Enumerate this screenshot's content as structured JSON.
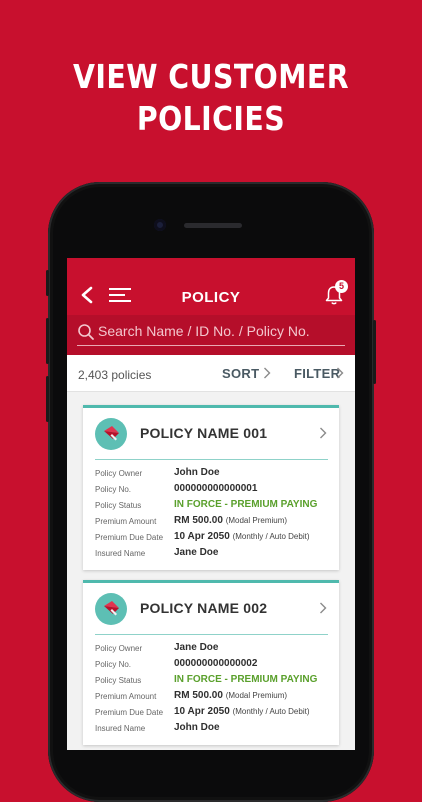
{
  "headline": {
    "line1": "VIEW CUSTOMER",
    "line2": "POLICIES"
  },
  "colors": {
    "brand_red": "#c8102e",
    "teal": "#4fb9ad",
    "status_green": "#5aa02c"
  },
  "app": {
    "title": "POLICY",
    "notification_count": "5",
    "search": {
      "placeholder": "Search Name / ID No. / Policy No."
    },
    "list": {
      "count": "2,403 policies",
      "sort_label": "SORT",
      "filter_label": "FILTER"
    }
  },
  "labels": {
    "owner": "Policy Owner",
    "number": "Policy No.",
    "status": "Policy Status",
    "premium": "Premium Amount",
    "due": "Premium Due Date",
    "insured": "Insured Name"
  },
  "policies": [
    {
      "name": "POLICY NAME 001",
      "owner": "John Doe",
      "number": "000000000000001",
      "status": "IN FORCE - PREMIUM PAYING",
      "premium": "RM 500.00",
      "premium_note": "(Modal Premium)",
      "due": "10 Apr 2050",
      "due_note": "(Monthly / Auto Debit)",
      "insured": "Jane Doe"
    },
    {
      "name": "POLICY NAME 002",
      "owner": "Jane Doe",
      "number": "000000000000002",
      "status": "IN FORCE - PREMIUM PAYING",
      "premium": "RM 500.00",
      "premium_note": "(Modal Premium)",
      "due": "10 Apr 2050",
      "due_note": "(Monthly / Auto Debit)",
      "insured": "John Doe"
    }
  ]
}
